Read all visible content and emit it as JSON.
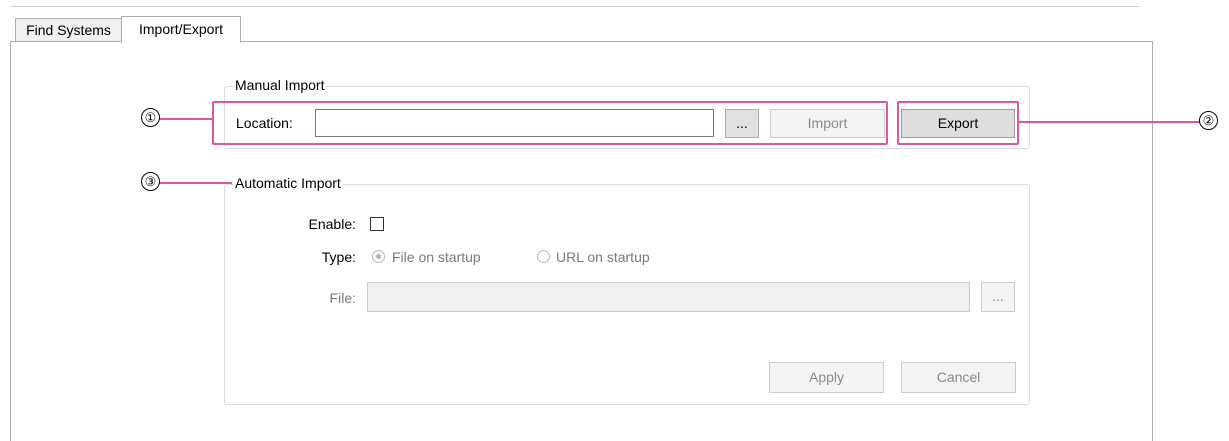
{
  "tabs": [
    {
      "label": "Find Systems",
      "active": false
    },
    {
      "label": "Import/Export",
      "active": true
    }
  ],
  "manual_import": {
    "legend": "Manual Import",
    "location_label": "Location:",
    "location_value": "",
    "browse_label": "...",
    "import_label": "Import",
    "export_label": "Export"
  },
  "automatic_import": {
    "legend": "Automatic Import",
    "enable_label": "Enable:",
    "enable_checked": false,
    "type_label": "Type:",
    "type_options": [
      {
        "label": "File on startup",
        "selected": true
      },
      {
        "label": "URL on startup",
        "selected": false
      }
    ],
    "file_label": "File:",
    "file_value": "",
    "browse_label": "...",
    "apply_label": "Apply",
    "cancel_label": "Cancel"
  },
  "callouts": [
    {
      "number": "①"
    },
    {
      "number": "②"
    },
    {
      "number": "③"
    }
  ],
  "colors": {
    "callout": "#e0559b",
    "disabled_text": "#8a8a8a"
  }
}
